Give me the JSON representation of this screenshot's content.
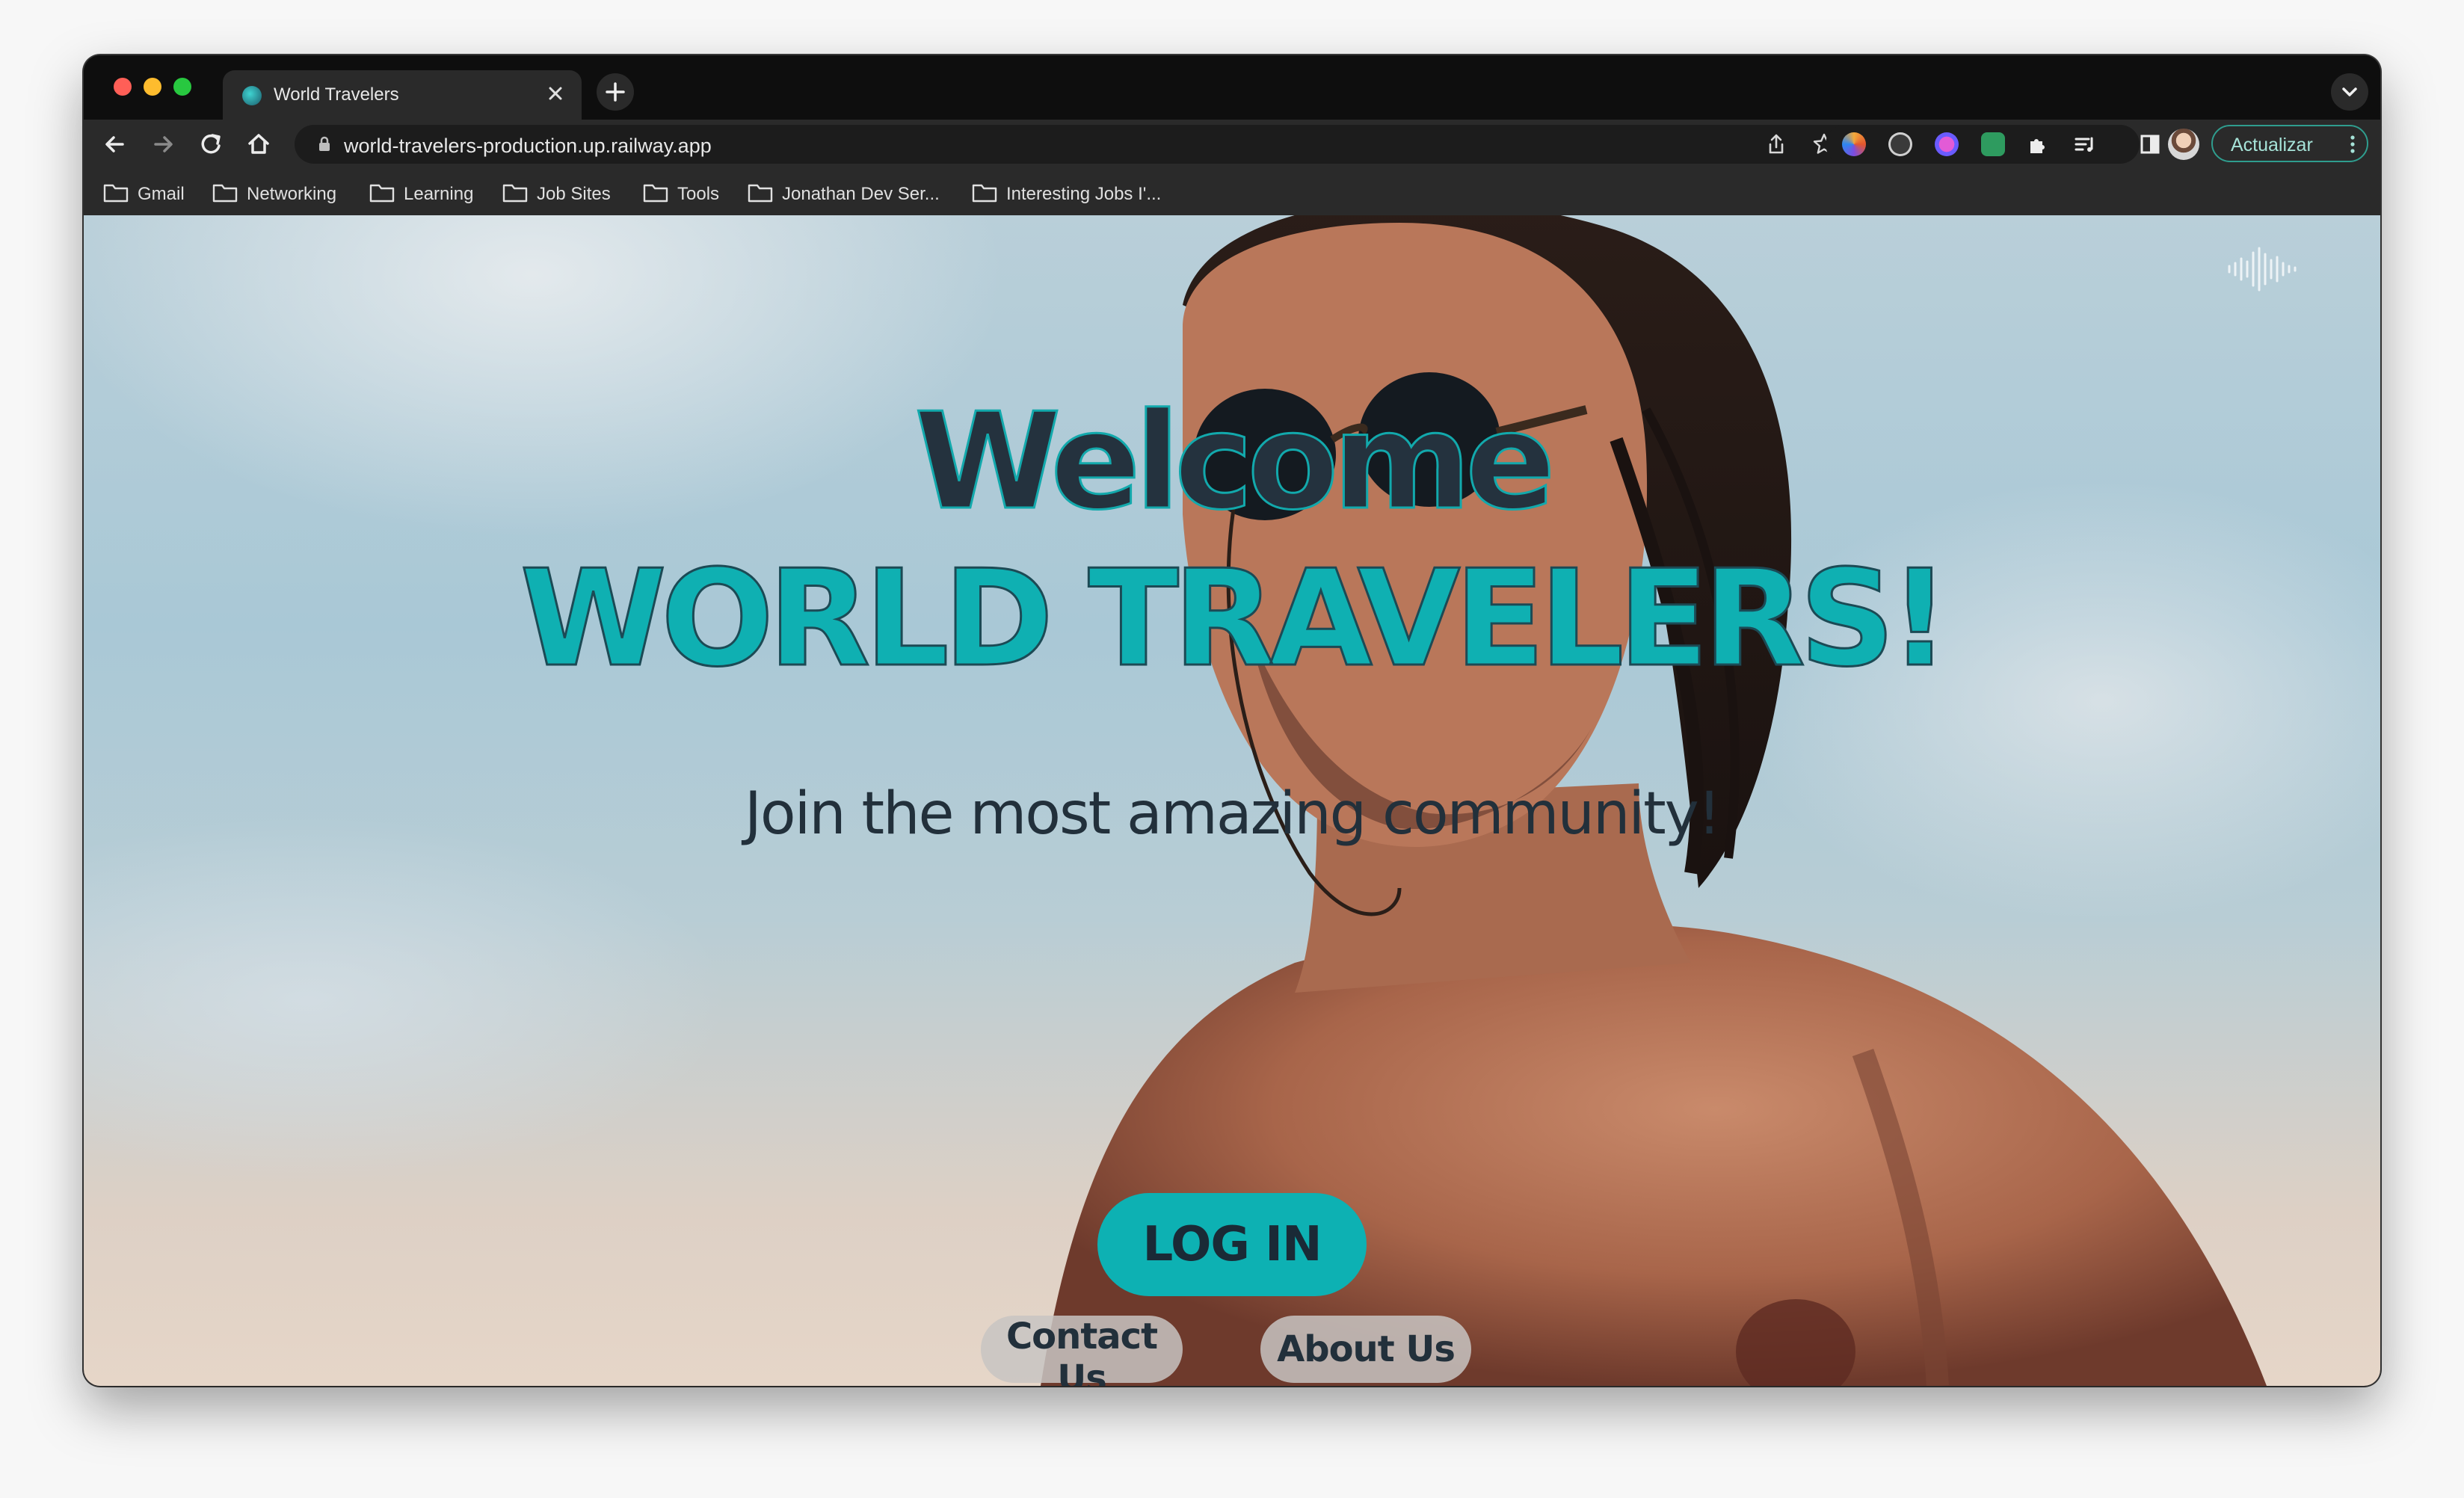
{
  "browser": {
    "tab": {
      "title": "World Travelers",
      "favicon": "world-travelers-favicon-icon"
    },
    "address": {
      "url": "world-travelers-production.up.railway.app"
    },
    "update_button": {
      "label": "Actualizar"
    },
    "bookmarks": [
      {
        "label": "Gmail"
      },
      {
        "label": "Networking"
      },
      {
        "label": "Learning"
      },
      {
        "label": "Job Sites"
      },
      {
        "label": "Tools"
      },
      {
        "label": "Jonathan Dev Ser..."
      },
      {
        "label": "Interesting Jobs I'..."
      }
    ],
    "icons": [
      "back-icon",
      "forward-icon",
      "reload-icon",
      "home-icon",
      "lock-icon",
      "share-icon",
      "star-icon",
      "extensions-icon",
      "reading-list-icon",
      "side-panel-icon",
      "kebab-menu-icon"
    ]
  },
  "page": {
    "heading_line1": "Welcome",
    "heading_line2": "WORLD TRAVELERS!",
    "tagline": "Join the most amazing community!",
    "login_button": "LOG IN",
    "contact_button": "Contact Us",
    "about_button": "About Us"
  },
  "colors": {
    "accent": "#0fb0b2",
    "heading_dark": "#24323e",
    "browser_frame": "#0e0e0e",
    "toolbar": "#2a2a2a"
  }
}
